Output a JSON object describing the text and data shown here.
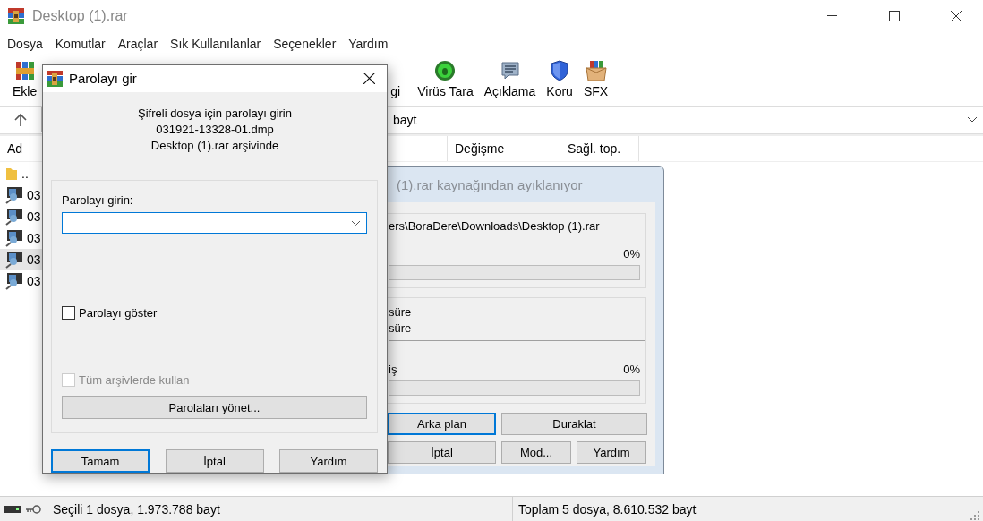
{
  "window": {
    "title": "Desktop (1).rar"
  },
  "menu": [
    "Dosya",
    "Komutlar",
    "Araçlar",
    "Sık Kullanılanlar",
    "Seçenekler",
    "Yardım"
  ],
  "toolbar": [
    {
      "label": "Ekle",
      "kind": "books"
    },
    {
      "label": "gi",
      "kind": "hidden"
    },
    {
      "label": "Virüs Tara",
      "kind": "bug"
    },
    {
      "label": "Açıklama",
      "kind": "note"
    },
    {
      "label": "Koru",
      "kind": "shield"
    },
    {
      "label": "SFX",
      "kind": "box"
    }
  ],
  "address": {
    "value": "bayt"
  },
  "columns": [
    "Ad",
    "Değişme",
    "Sağl. top."
  ],
  "files": [
    {
      "name": "..",
      "kind": "folder",
      "selected": false
    },
    {
      "name": "03",
      "kind": "dump",
      "selected": false
    },
    {
      "name": "03",
      "kind": "dump",
      "selected": false
    },
    {
      "name": "03",
      "kind": "dump",
      "selected": false
    },
    {
      "name": "03",
      "kind": "dump",
      "selected": true
    },
    {
      "name": "03",
      "kind": "dump",
      "selected": false
    }
  ],
  "extract_dialog": {
    "title": "(1).rar kaynağından ayıklanıyor",
    "path": "ers\\BoraDere\\Downloads\\Desktop (1).rar",
    "progress_1": {
      "reading": "0%",
      "level": 0
    },
    "time_labels": [
      "süre",
      "süre"
    ],
    "progress_2": {
      "label": "iş",
      "reading": "0%",
      "level": 0
    },
    "buttons": [
      {
        "label": "Arka plan",
        "default": true
      },
      {
        "label": "Duraklat",
        "default": false
      },
      {
        "label": "İptal",
        "default": false
      },
      {
        "label": "Mod...",
        "default": false
      },
      {
        "label": "Yardım",
        "default": false
      }
    ]
  },
  "password_dialog": {
    "title": "Parolayı gir",
    "message": [
      "Şifreli dosya için parolayı girin",
      "031921-13328-01.dmp",
      "Desktop (1).rar arşivinde"
    ],
    "field_label": "Parolayı girin:",
    "show_password": {
      "label": "Parolayı göster",
      "checked": false,
      "disabled": false
    },
    "use_all": {
      "label": "Tüm arşivlerde kullan",
      "checked": false,
      "disabled": true
    },
    "manage_button": "Parolaları yönet...",
    "buttons": [
      {
        "label": "Tamam",
        "default": true
      },
      {
        "label": "İptal",
        "default": false
      },
      {
        "label": "Yardım",
        "default": false
      }
    ]
  },
  "status_bar": [
    "Seçili 1 dosya, 1.973.788 bayt",
    "Toplam 5 dosya, 8.610.532 bayt"
  ]
}
